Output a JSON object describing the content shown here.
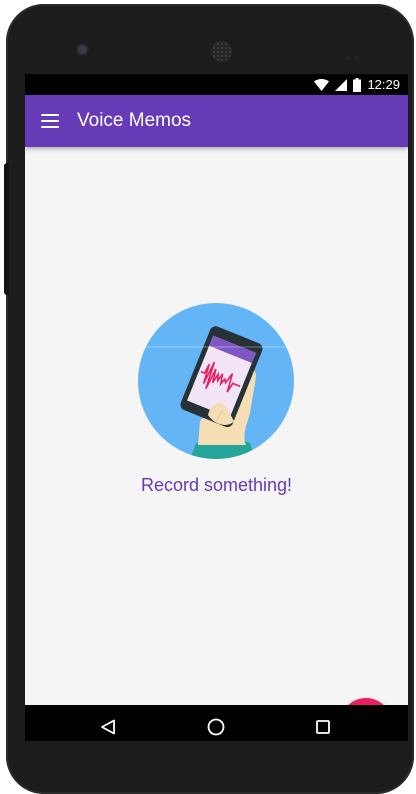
{
  "status_bar": {
    "time": "12:29",
    "icons": [
      "wifi-icon",
      "signal-icon",
      "battery-icon"
    ]
  },
  "app_bar": {
    "menu_icon": "menu-icon",
    "title": "Voice Memos",
    "color": "#673ab7"
  },
  "empty_state": {
    "illustration": "phone-recording-illustration",
    "message": "Record something!"
  },
  "fab": {
    "icon": "plus-icon",
    "color": "#e91e63"
  },
  "nav_bar": {
    "buttons": [
      "back-icon",
      "home-icon",
      "recents-icon"
    ]
  },
  "colors": {
    "primary": "#673ab7",
    "accent": "#e91e63",
    "background": "#f5f5f5",
    "illustration_circle": "#64b5f6"
  }
}
